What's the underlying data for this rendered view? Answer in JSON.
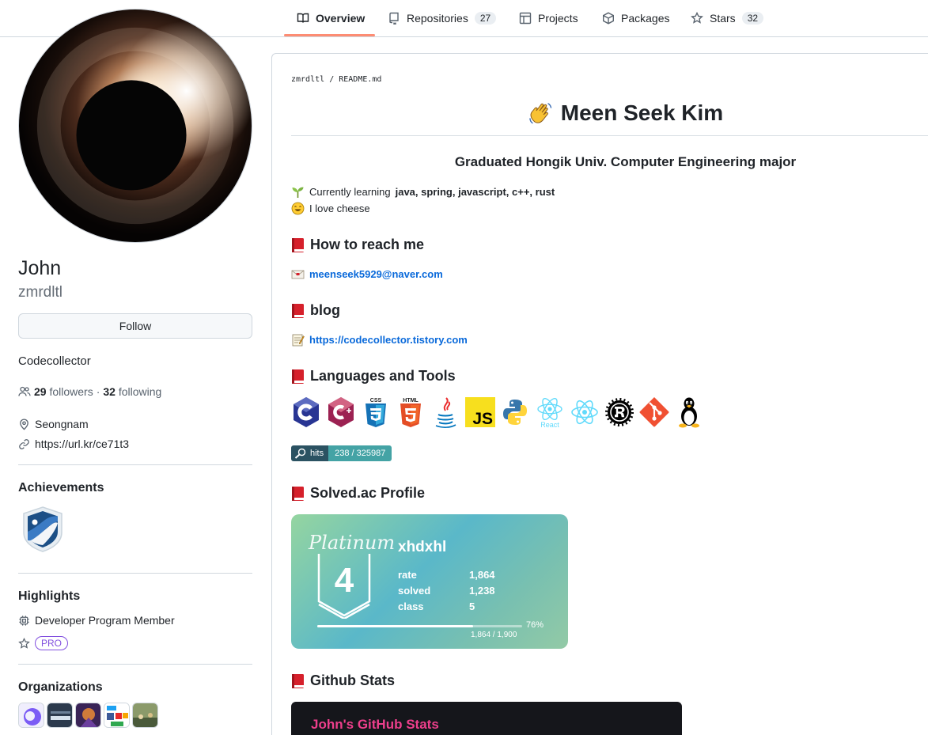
{
  "nav": {
    "tabs": [
      {
        "label": "Overview",
        "icon": "book-icon",
        "count": ""
      },
      {
        "label": "Repositories",
        "icon": "repo-icon",
        "count": "27"
      },
      {
        "label": "Projects",
        "icon": "project-icon",
        "count": ""
      },
      {
        "label": "Packages",
        "icon": "package-icon",
        "count": ""
      },
      {
        "label": "Stars",
        "icon": "star-icon",
        "count": "32"
      }
    ],
    "active_tab": "Overview"
  },
  "profile": {
    "name": "John",
    "login": "zmrdltl",
    "follow_label": "Follow",
    "bio": "Codecollector",
    "followers_count": "29",
    "followers_label": "followers",
    "following_count": "32",
    "following_label": "following",
    "separator": "·",
    "location": "Seongnam",
    "website": "https://url.kr/ce71t3"
  },
  "sidebar": {
    "achievements_title": "Achievements",
    "highlights_title": "Highlights",
    "highlight_member": "Developer Program Member",
    "pro_label": "PRO",
    "organizations_title": "Organizations"
  },
  "readme": {
    "path_user": "zmrdltl",
    "path_sep": "/",
    "path_file": "README.md",
    "title": "Meen Seek Kim",
    "subtitle": "Graduated Hongik Univ. Computer Engineering major",
    "learning_prefix": "Currently learning",
    "learning_items": "java, spring, javascript, c++, rust",
    "cheese": "I love cheese",
    "reach_title": "How to reach me",
    "email": "meenseek5929@naver.com",
    "blog_title": "blog",
    "blog_url": "https://codecollector.tistory.com",
    "tools_title": "Languages and Tools",
    "react_label": "React",
    "hits_label": "hits",
    "hits_value": "238 / 325987",
    "solved_title": "Solved.ac Profile",
    "stats_title": "Github Stats"
  },
  "solved": {
    "tier": "Platinum",
    "tier_level": "4",
    "handle": "xhdxhl",
    "rows": [
      {
        "key": "rate",
        "value": "1,864"
      },
      {
        "key": "solved",
        "value": "1,238"
      },
      {
        "key": "class",
        "value": "5"
      }
    ],
    "progress_pct": 76,
    "progress_label": "76%",
    "progress_text": "1,864 / 1,900"
  },
  "stats_card": {
    "title": "John's GitHub Stats"
  },
  "colors": {
    "accent_tab": "#fd8c73",
    "link": "#0969da",
    "pro": "#8250df",
    "stats_title": "#ee3f8c"
  }
}
